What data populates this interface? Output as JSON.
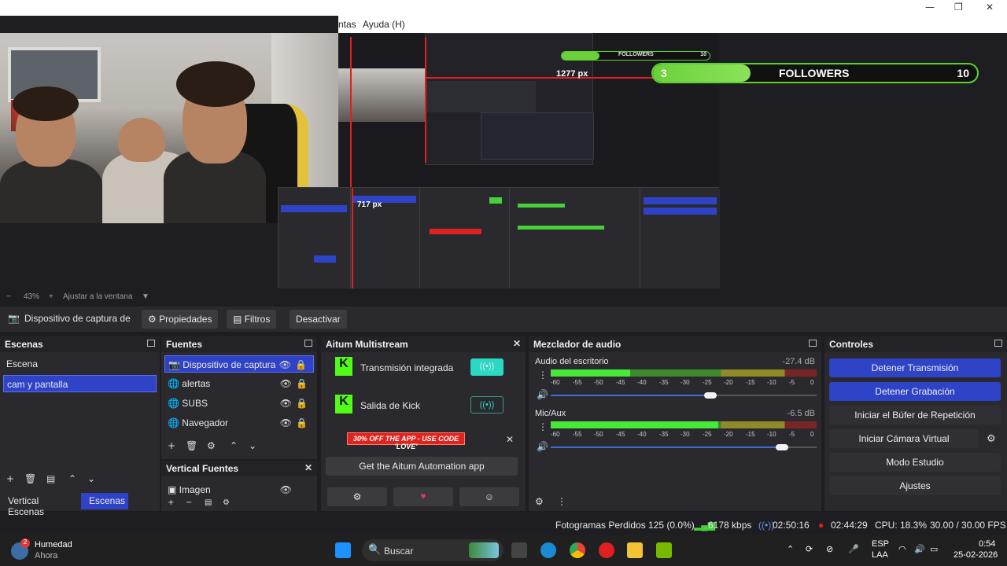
{
  "window": {
    "controls": [
      "—",
      "❐",
      "✕"
    ]
  },
  "menubar": {
    "items": [
      "ntas",
      "Ayuda (H)"
    ]
  },
  "overlay": {
    "followers_current": "3",
    "followers_title": "FOLLOWERS",
    "followers_goal": "10",
    "progress_fraction": 0.3
  },
  "preview": {
    "measure_width": "1277 px",
    "measure_height": "717 px",
    "nested_followers": "FOLLOWERS",
    "nested_goal": "10"
  },
  "zoom": {
    "value": "43%",
    "fit_label": "Ajustar a la ventana"
  },
  "source_toolbar": {
    "source_name": "Dispositivo de captura de v",
    "properties": "Propiedades",
    "filters": "Filtros",
    "deactivate": "Desactivar"
  },
  "scenes": {
    "title": "Escenas",
    "items": [
      {
        "label": "Escena"
      },
      {
        "label": "cam y pantalla",
        "selected": true
      }
    ],
    "bottom_tabs": [
      "Vertical Escenas",
      "Escenas"
    ]
  },
  "sources": {
    "title": "Fuentes",
    "items": [
      {
        "label": "Dispositivo de captura",
        "icon": "camera-icon",
        "selected": true
      },
      {
        "label": "alertas",
        "icon": "globe-icon"
      },
      {
        "label": "SUBS",
        "icon": "globe-icon"
      },
      {
        "label": "Navegador",
        "icon": "globe-icon"
      }
    ],
    "vertical_title": "Vertical Fuentes",
    "vertical_item": "Imagen"
  },
  "multistream": {
    "title": "Aitum Multistream",
    "outputs": [
      {
        "label": "Transmisión integrada",
        "active": true
      },
      {
        "label": "Salida de Kick",
        "active": false
      }
    ],
    "promo": "30% OFF THE APP - USE CODE 'LOVE'",
    "cta": "Get the Aitum Automation app"
  },
  "mixer": {
    "title": "Mezclador de audio",
    "channels": [
      {
        "name": "Audio del escritorio",
        "db": "-27.4 dB",
        "level": 0.3,
        "peak": 0.55,
        "volume": 0.6
      },
      {
        "name": "Mic/Aux",
        "db": "-6.5 dB",
        "level": 0.63,
        "peak": 0.71,
        "volume": 0.87
      }
    ],
    "scale": [
      "-60",
      "-55",
      "-50",
      "-45",
      "-40",
      "-35",
      "-30",
      "-25",
      "-20",
      "-15",
      "-10",
      "-5",
      "0"
    ]
  },
  "controls": {
    "title": "Controles",
    "buttons": [
      {
        "label": "Detener Transmisión",
        "active": true
      },
      {
        "label": "Detener Grabación",
        "active": true
      },
      {
        "label": "Iniciar el Búfer de Repetición",
        "active": false
      },
      {
        "label": "Iniciar Cámara Virtual",
        "active": false
      },
      {
        "label": "Modo Estudio",
        "active": false
      },
      {
        "label": "Ajustes",
        "active": false
      }
    ]
  },
  "status": {
    "dropped": "Fotogramas Perdidos 125 (0.0%)",
    "bitrate": "6178 kbps",
    "stream_time": "02:50:16",
    "rec_time": "02:44:29",
    "cpu": "CPU: 18.3%",
    "fps": "30.00 / 30.00 FPS"
  },
  "taskbar": {
    "weather_label": "Humedad",
    "weather_sub": "Ahora",
    "weather_badge": "2",
    "search": "Buscar",
    "lang_top": "ESP",
    "lang_bottom": "LAA",
    "time": "0:54",
    "date": "25-02-2026"
  },
  "colors": {
    "accent": "#2f43c7",
    "meter_green": "#46e83a",
    "overlay_green": "#6bd13a",
    "record_red": "#e02020"
  }
}
